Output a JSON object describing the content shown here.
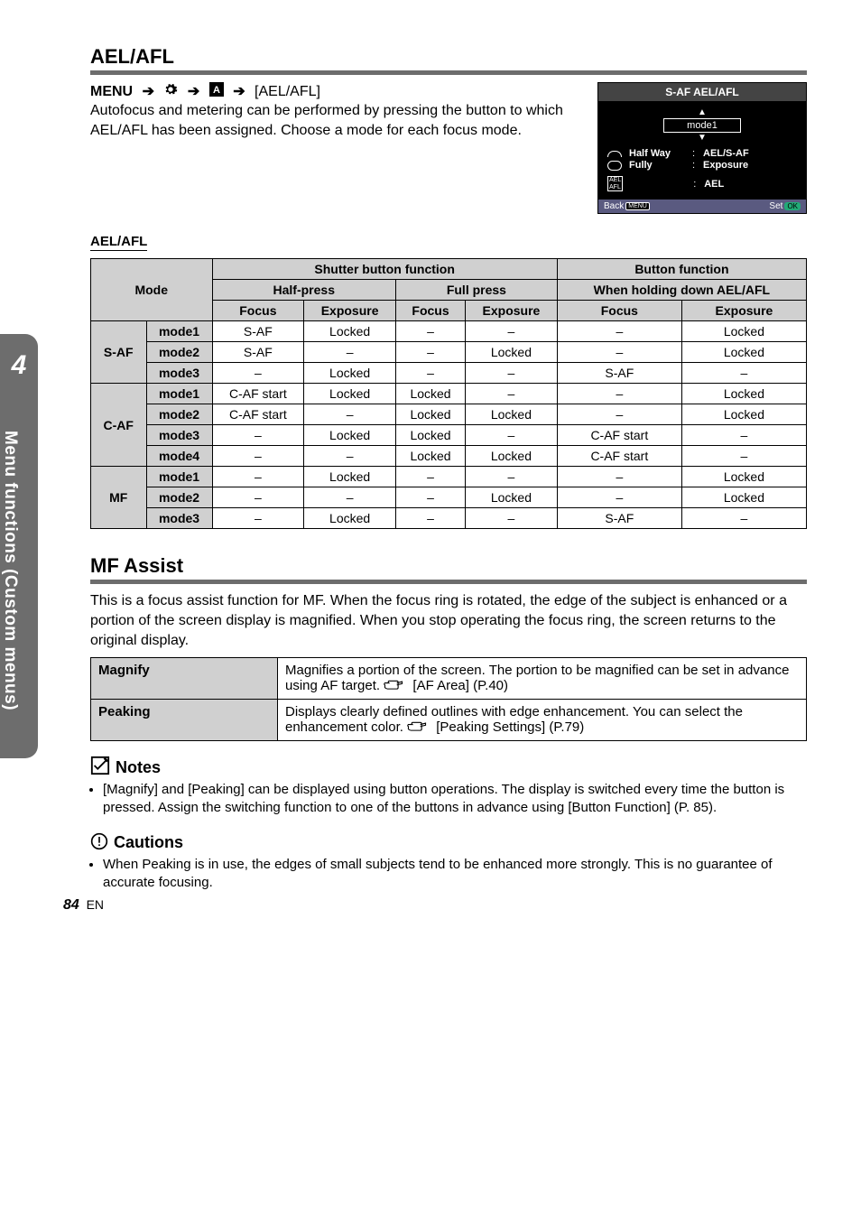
{
  "side_tab": {
    "num": "4",
    "text": "Menu functions (Custom menus)"
  },
  "ael": {
    "title": "AEL/AFL",
    "menu_prefix": "MENU",
    "menu_item": "[AEL/AFL]",
    "desc": "Autofocus and metering can be performed by pressing the button to which AEL/AFL has been assigned. Choose a mode for each focus mode.",
    "menubox": {
      "title": "S-AF AEL/AFL",
      "mode": "mode1",
      "rows": [
        {
          "key": "Half Way",
          "val": "AEL/S-AF"
        },
        {
          "key": "Fully",
          "val": "Exposure"
        },
        {
          "key": "",
          "val": "AEL"
        }
      ],
      "back": "Back",
      "set": "Set"
    },
    "table_heading": "AEL/AFL",
    "headers": {
      "mode": "Mode",
      "shutter": "Shutter button function",
      "button": "Button function",
      "half": "Half-press",
      "full": "Full press",
      "hold": "When holding down AEL/AFL",
      "focus": "Focus",
      "exposure": "Exposure"
    },
    "groups": [
      {
        "name": "S-AF",
        "rows": [
          {
            "m": "mode1",
            "hf": "S-AF",
            "he": "Locked",
            "ff": "–",
            "fe": "–",
            "bf": "–",
            "be": "Locked"
          },
          {
            "m": "mode2",
            "hf": "S-AF",
            "he": "–",
            "ff": "–",
            "fe": "Locked",
            "bf": "–",
            "be": "Locked"
          },
          {
            "m": "mode3",
            "hf": "–",
            "he": "Locked",
            "ff": "–",
            "fe": "–",
            "bf": "S-AF",
            "be": "–"
          }
        ]
      },
      {
        "name": "C-AF",
        "rows": [
          {
            "m": "mode1",
            "hf": "C-AF start",
            "he": "Locked",
            "ff": "Locked",
            "fe": "–",
            "bf": "–",
            "be": "Locked"
          },
          {
            "m": "mode2",
            "hf": "C-AF start",
            "he": "–",
            "ff": "Locked",
            "fe": "Locked",
            "bf": "–",
            "be": "Locked"
          },
          {
            "m": "mode3",
            "hf": "–",
            "he": "Locked",
            "ff": "Locked",
            "fe": "–",
            "bf": "C-AF start",
            "be": "–"
          },
          {
            "m": "mode4",
            "hf": "–",
            "he": "–",
            "ff": "Locked",
            "fe": "Locked",
            "bf": "C-AF start",
            "be": "–"
          }
        ]
      },
      {
        "name": "MF",
        "rows": [
          {
            "m": "mode1",
            "hf": "–",
            "he": "Locked",
            "ff": "–",
            "fe": "–",
            "bf": "–",
            "be": "Locked"
          },
          {
            "m": "mode2",
            "hf": "–",
            "he": "–",
            "ff": "–",
            "fe": "Locked",
            "bf": "–",
            "be": "Locked"
          },
          {
            "m": "mode3",
            "hf": "–",
            "he": "Locked",
            "ff": "–",
            "fe": "–",
            "bf": "S-AF",
            "be": "–"
          }
        ]
      }
    ]
  },
  "mf": {
    "title": "MF Assist",
    "desc": "This is a focus assist function for MF. When the focus ring is rotated, the edge of the subject is enhanced or a portion of the screen display is magnified. When you stop operating the focus ring, the screen returns to the original display.",
    "rows": [
      {
        "label": "Magnify",
        "text_a": "Magnifies a portion of the screen. The portion to be magnified can be set in advance using AF target. ",
        "text_b": " [AF Area] (P.40)"
      },
      {
        "label": "Peaking",
        "text_a": "Displays clearly defined outlines with edge enhancement. You can select the enhancement color. ",
        "text_b": " [Peaking Settings] (P.79)"
      }
    ]
  },
  "notes": {
    "title": "Notes",
    "items": [
      "[Magnify] and [Peaking] can be displayed using button operations. The display is switched every time the button is pressed. Assign the switching function to one of the buttons in advance using [Button Function] (P. 85)."
    ]
  },
  "cautions": {
    "title": "Cautions",
    "items": [
      "When Peaking is in use, the edges of small subjects tend to be enhanced more strongly. This is no guarantee of accurate focusing."
    ]
  },
  "footer": {
    "page": "84",
    "lang": "EN"
  }
}
